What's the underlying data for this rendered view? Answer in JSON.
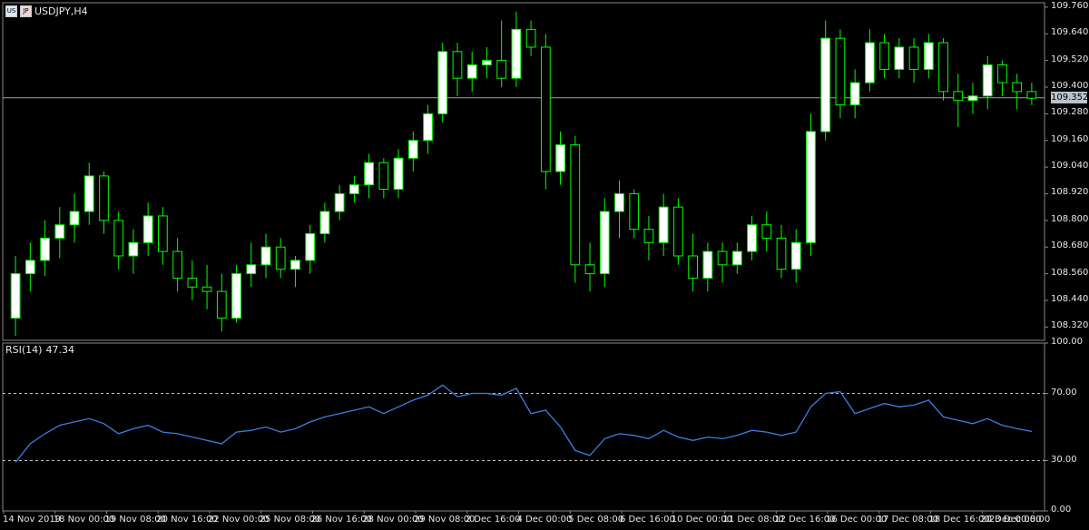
{
  "header": {
    "symbol_label": "USDJPY,H4"
  },
  "rsi_panel": {
    "label": "RSI(14)",
    "value": "47.34"
  },
  "price_axis": {
    "ticks": [
      "109.760",
      "109.640",
      "109.520",
      "109.400",
      "109.280",
      "109.160",
      "109.040",
      "108.920",
      "108.800",
      "108.680",
      "108.560",
      "108.440",
      "108.320"
    ],
    "current_price": "109.352"
  },
  "rsi_axis": {
    "ticks": [
      "100.00",
      "70.00",
      "30.00",
      "0.00"
    ]
  },
  "time_axis": {
    "labels": [
      "14 Nov 2019",
      "18 Nov 00:00",
      "19 Nov 08:00",
      "20 Nov 16:00",
      "22 Nov 00:00",
      "25 Nov 08:00",
      "26 Nov 16:00",
      "28 Nov 00:00",
      "29 Nov 08:00",
      "2 Dec 16:00",
      "4 Dec 00:00",
      "5 Dec 08:00",
      "6 Dec 16:00",
      "10 Dec 00:00",
      "11 Dec 08:00",
      "12 Dec 16:00",
      "16 Dec 00:00",
      "17 Dec 08:00",
      "18 Dec 16:00",
      "20 Dec 00:00",
      "23 Dec 08:00"
    ]
  },
  "colors": {
    "up": "#00ff00",
    "up_body": "#ffffff",
    "down": "#00ff00",
    "down_body": "#000000",
    "rsi_line": "#3b7fe0",
    "grid_border": "#888888",
    "level_dash": "#c0c0c0"
  },
  "chart_data": [
    {
      "type": "candlestick",
      "title": "USDJPY,H4",
      "ylim": [
        108.26,
        109.78
      ],
      "current_price": 109.352,
      "ohlc": [
        [
          108.36,
          108.64,
          108.28,
          108.56
        ],
        [
          108.56,
          108.7,
          108.48,
          108.62
        ],
        [
          108.62,
          108.8,
          108.55,
          108.72
        ],
        [
          108.72,
          108.86,
          108.63,
          108.78
        ],
        [
          108.78,
          108.92,
          108.7,
          108.84
        ],
        [
          108.84,
          109.06,
          108.78,
          109.0
        ],
        [
          109.0,
          109.02,
          108.74,
          108.8
        ],
        [
          108.8,
          108.84,
          108.58,
          108.64
        ],
        [
          108.64,
          108.76,
          108.56,
          108.7
        ],
        [
          108.7,
          108.88,
          108.64,
          108.82
        ],
        [
          108.82,
          108.86,
          108.6,
          108.66
        ],
        [
          108.66,
          108.72,
          108.48,
          108.54
        ],
        [
          108.54,
          108.62,
          108.44,
          108.5
        ],
        [
          108.5,
          108.6,
          108.4,
          108.48
        ],
        [
          108.48,
          108.56,
          108.3,
          108.36
        ],
        [
          108.36,
          108.6,
          108.34,
          108.56
        ],
        [
          108.56,
          108.7,
          108.5,
          108.6
        ],
        [
          108.6,
          108.74,
          108.54,
          108.68
        ],
        [
          108.68,
          108.72,
          108.54,
          108.58
        ],
        [
          108.58,
          108.64,
          108.5,
          108.62
        ],
        [
          108.62,
          108.78,
          108.56,
          108.74
        ],
        [
          108.74,
          108.88,
          108.7,
          108.84
        ],
        [
          108.84,
          108.96,
          108.8,
          108.92
        ],
        [
          108.92,
          109.0,
          108.88,
          108.96
        ],
        [
          108.96,
          109.1,
          108.9,
          109.06
        ],
        [
          109.06,
          109.08,
          108.9,
          108.94
        ],
        [
          108.94,
          109.12,
          108.9,
          109.08
        ],
        [
          109.08,
          109.2,
          109.02,
          109.16
        ],
        [
          109.16,
          109.32,
          109.1,
          109.28
        ],
        [
          109.28,
          109.6,
          109.24,
          109.56
        ],
        [
          109.56,
          109.6,
          109.36,
          109.44
        ],
        [
          109.44,
          109.56,
          109.38,
          109.5
        ],
        [
          109.5,
          109.58,
          109.44,
          109.52
        ],
        [
          109.52,
          109.7,
          109.4,
          109.44
        ],
        [
          109.44,
          109.74,
          109.4,
          109.66
        ],
        [
          109.66,
          109.7,
          109.54,
          109.58
        ],
        [
          109.58,
          109.64,
          108.94,
          109.02
        ],
        [
          109.02,
          109.2,
          108.96,
          109.14
        ],
        [
          109.14,
          109.18,
          108.52,
          108.6
        ],
        [
          108.6,
          108.7,
          108.48,
          108.56
        ],
        [
          108.56,
          108.9,
          108.5,
          108.84
        ],
        [
          108.84,
          108.98,
          108.72,
          108.92
        ],
        [
          108.92,
          108.94,
          108.72,
          108.76
        ],
        [
          108.76,
          108.82,
          108.62,
          108.7
        ],
        [
          108.7,
          108.92,
          108.64,
          108.86
        ],
        [
          108.86,
          108.9,
          108.6,
          108.64
        ],
        [
          108.64,
          108.74,
          108.48,
          108.54
        ],
        [
          108.54,
          108.7,
          108.48,
          108.66
        ],
        [
          108.66,
          108.7,
          108.52,
          108.6
        ],
        [
          108.6,
          108.7,
          108.56,
          108.66
        ],
        [
          108.66,
          108.82,
          108.62,
          108.78
        ],
        [
          108.78,
          108.84,
          108.66,
          108.72
        ],
        [
          108.72,
          108.78,
          108.54,
          108.58
        ],
        [
          108.58,
          108.76,
          108.52,
          108.7
        ],
        [
          108.7,
          109.28,
          108.64,
          109.2
        ],
        [
          109.2,
          109.7,
          109.16,
          109.62
        ],
        [
          109.62,
          109.66,
          109.26,
          109.32
        ],
        [
          109.32,
          109.48,
          109.26,
          109.42
        ],
        [
          109.42,
          109.66,
          109.38,
          109.6
        ],
        [
          109.6,
          109.64,
          109.44,
          109.48
        ],
        [
          109.48,
          109.62,
          109.44,
          109.58
        ],
        [
          109.58,
          109.62,
          109.42,
          109.48
        ],
        [
          109.48,
          109.64,
          109.44,
          109.6
        ],
        [
          109.6,
          109.62,
          109.34,
          109.38
        ],
        [
          109.38,
          109.46,
          109.22,
          109.34
        ],
        [
          109.34,
          109.42,
          109.28,
          109.36
        ],
        [
          109.36,
          109.54,
          109.3,
          109.5
        ],
        [
          109.5,
          109.52,
          109.36,
          109.42
        ],
        [
          109.42,
          109.46,
          109.3,
          109.38
        ],
        [
          109.38,
          109.42,
          109.32,
          109.35
        ]
      ]
    },
    {
      "type": "line",
      "title": "RSI(14) 47.34",
      "ylim": [
        0,
        100
      ],
      "levels": [
        70,
        30
      ],
      "series": [
        {
          "values": [
            29,
            40,
            46,
            51,
            53,
            55,
            52,
            46,
            49,
            51,
            47,
            46,
            44,
            42,
            40,
            47,
            48,
            50,
            47,
            49,
            53,
            56,
            58,
            60,
            62,
            58,
            62,
            66,
            69,
            75,
            68,
            70,
            70,
            69,
            73,
            58,
            60,
            50,
            36,
            33,
            43,
            46,
            45,
            43,
            48,
            44,
            42,
            44,
            43,
            45,
            48,
            47,
            45,
            47,
            62,
            70,
            71,
            58,
            61,
            64,
            62,
            63,
            66,
            56,
            54,
            52,
            55,
            51,
            49,
            47.34
          ]
        }
      ]
    }
  ]
}
